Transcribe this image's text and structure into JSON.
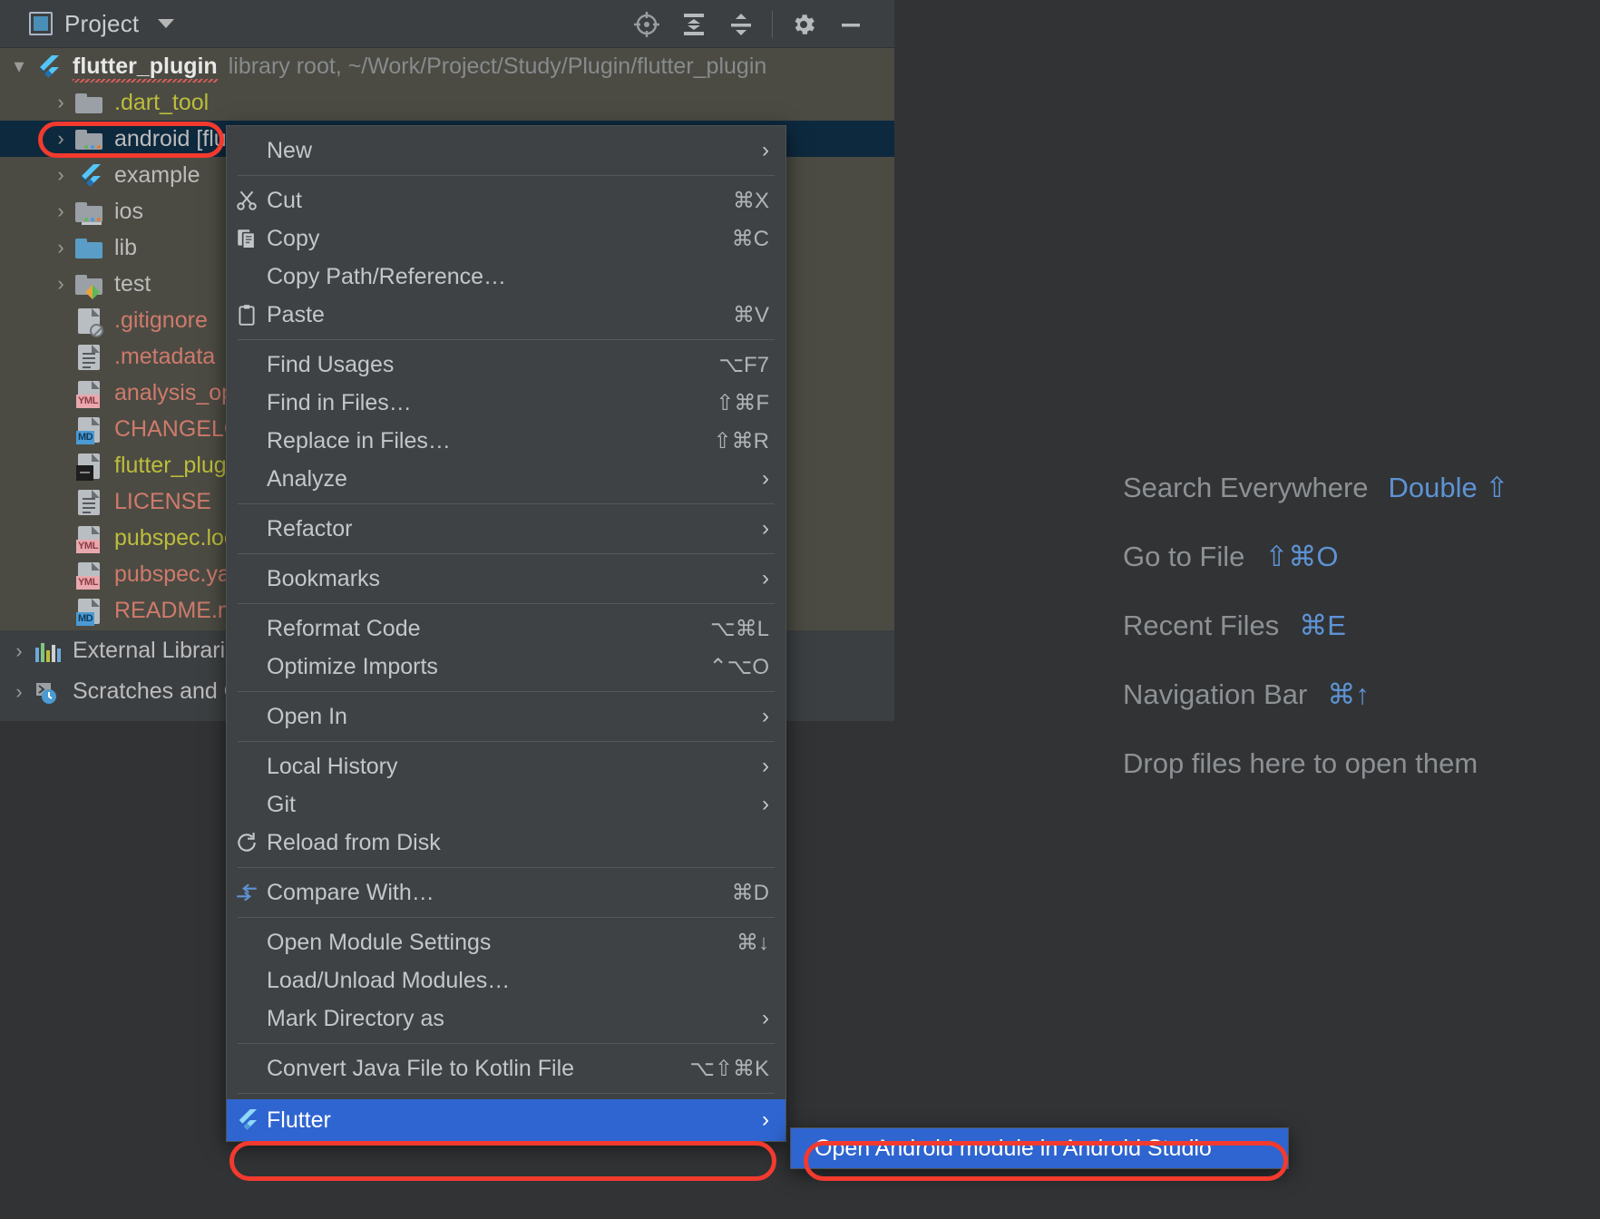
{
  "window": {
    "tool_window_title": "Project",
    "actions": [
      {
        "name": "locate-icon",
        "label": "Select Opened File"
      },
      {
        "name": "expand-all-icon",
        "label": "Expand All"
      },
      {
        "name": "collapse-all-icon",
        "label": "Collapse All"
      },
      {
        "name": "gear-icon",
        "label": "Options"
      },
      {
        "name": "minimize-icon",
        "label": "Hide"
      }
    ]
  },
  "tree": [
    {
      "label": "flutter_plugin",
      "suffix": "library root, ~/Work/Project/Study/Plugin/flutter_plugin",
      "icon": "flutter-icon",
      "arrow": "open",
      "indent": 0,
      "style": "root"
    },
    {
      "label": ".dart_tool",
      "icon": "folder-grey-icon",
      "arrow": "closed",
      "indent": 1,
      "style": "yellow"
    },
    {
      "label": "android [flutter_plugin_android]",
      "icon": "folder-module-icon",
      "arrow": "closed",
      "indent": 1,
      "style": "grey",
      "selected": true
    },
    {
      "label": "example",
      "icon": "flutter-icon",
      "arrow": "closed",
      "indent": 1,
      "style": "grey"
    },
    {
      "label": "ios",
      "icon": "folder-module-icon",
      "arrow": "closed",
      "indent": 1,
      "style": "grey"
    },
    {
      "label": "lib",
      "icon": "folder-blue-icon",
      "arrow": "closed",
      "indent": 1,
      "style": "grey"
    },
    {
      "label": "test",
      "icon": "folder-test-icon",
      "arrow": "closed",
      "indent": 1,
      "style": "grey"
    },
    {
      "label": ".gitignore",
      "icon": "file-ignore-icon",
      "arrow": "none",
      "indent": 1,
      "style": "red"
    },
    {
      "label": ".metadata",
      "icon": "file-text-icon",
      "arrow": "none",
      "indent": 1,
      "style": "red"
    },
    {
      "label": "analysis_options.yaml",
      "icon": "file-yml-icon",
      "arrow": "none",
      "indent": 1,
      "style": "red"
    },
    {
      "label": "CHANGELOG.md",
      "icon": "file-md-icon",
      "arrow": "none",
      "indent": 1,
      "style": "red"
    },
    {
      "label": "flutter_plugin.iml",
      "icon": "file-iml-icon",
      "arrow": "none",
      "indent": 1,
      "style": "yellow"
    },
    {
      "label": "LICENSE",
      "icon": "file-text-icon",
      "arrow": "none",
      "indent": 1,
      "style": "red"
    },
    {
      "label": "pubspec.lock",
      "icon": "file-yml-icon",
      "arrow": "none",
      "indent": 1,
      "style": "yellow"
    },
    {
      "label": "pubspec.yaml",
      "icon": "file-yml-icon",
      "arrow": "none",
      "indent": 1,
      "style": "red"
    },
    {
      "label": "README.md",
      "icon": "file-md-icon",
      "arrow": "none",
      "indent": 1,
      "style": "red"
    },
    {
      "label": "External Libraries",
      "icon": "external-libraries-icon",
      "arrow": "closed",
      "indent": 0,
      "style": "grey"
    },
    {
      "label": "Scratches and Consoles",
      "icon": "scratches-icon",
      "arrow": "closed",
      "indent": 0,
      "style": "grey"
    }
  ],
  "hints": [
    {
      "label": "Search Everywhere",
      "key": "Double ⇧"
    },
    {
      "label": "Go to File",
      "key": "⇧⌘O"
    },
    {
      "label": "Recent Files",
      "key": "⌘E"
    },
    {
      "label": "Navigation Bar",
      "key": "⌘↑"
    },
    {
      "label": "Drop files here to open them",
      "key": ""
    }
  ],
  "context_menu": {
    "groups": [
      [
        {
          "label": "New",
          "key": "",
          "arrow": true,
          "icon": ""
        }
      ],
      [
        {
          "label": "Cut",
          "key": "⌘X",
          "arrow": false,
          "icon": "scissors-icon"
        },
        {
          "label": "Copy",
          "key": "⌘C",
          "arrow": false,
          "icon": "copy-icon"
        },
        {
          "label": "Copy Path/Reference…",
          "key": "",
          "arrow": false,
          "icon": ""
        },
        {
          "label": "Paste",
          "key": "⌘V",
          "arrow": false,
          "icon": "clipboard-icon"
        }
      ],
      [
        {
          "label": "Find Usages",
          "key": "⌥F7",
          "arrow": false,
          "icon": ""
        },
        {
          "label": "Find in Files…",
          "key": "⇧⌘F",
          "arrow": false,
          "icon": ""
        },
        {
          "label": "Replace in Files…",
          "key": "⇧⌘R",
          "arrow": false,
          "icon": ""
        },
        {
          "label": "Analyze",
          "key": "",
          "arrow": true,
          "icon": ""
        }
      ],
      [
        {
          "label": "Refactor",
          "key": "",
          "arrow": true,
          "icon": ""
        }
      ],
      [
        {
          "label": "Bookmarks",
          "key": "",
          "arrow": true,
          "icon": ""
        }
      ],
      [
        {
          "label": "Reformat Code",
          "key": "⌥⌘L",
          "arrow": false,
          "icon": ""
        },
        {
          "label": "Optimize Imports",
          "key": "⌃⌥O",
          "arrow": false,
          "icon": ""
        }
      ],
      [
        {
          "label": "Open In",
          "key": "",
          "arrow": true,
          "icon": ""
        }
      ],
      [
        {
          "label": "Local History",
          "key": "",
          "arrow": true,
          "icon": ""
        },
        {
          "label": "Git",
          "key": "",
          "arrow": true,
          "icon": ""
        },
        {
          "label": "Reload from Disk",
          "key": "",
          "arrow": false,
          "icon": "reload-icon"
        }
      ],
      [
        {
          "label": "Compare With…",
          "key": "⌘D",
          "arrow": false,
          "icon": "compare-icon"
        }
      ],
      [
        {
          "label": "Open Module Settings",
          "key": "⌘↓",
          "arrow": false,
          "icon": ""
        },
        {
          "label": "Load/Unload Modules…",
          "key": "",
          "arrow": false,
          "icon": ""
        },
        {
          "label": "Mark Directory as",
          "key": "",
          "arrow": true,
          "icon": ""
        }
      ],
      [
        {
          "label": "Convert Java File to Kotlin File",
          "key": "⌥⇧⌘K",
          "arrow": false,
          "icon": ""
        }
      ],
      [
        {
          "label": "Flutter",
          "key": "",
          "arrow": true,
          "icon": "flutter-icon",
          "highlight": true
        }
      ]
    ]
  },
  "submenu": {
    "items": [
      {
        "label": "Open Android module in Android Studio",
        "highlight": true
      }
    ]
  },
  "colors": {
    "accent_selection": "#2f65d0",
    "annotation_red": "#f23a2e",
    "hint_key_blue": "#5e93d4",
    "menu_bg": "#3f4244",
    "tree_bg": "#4b4b43"
  }
}
